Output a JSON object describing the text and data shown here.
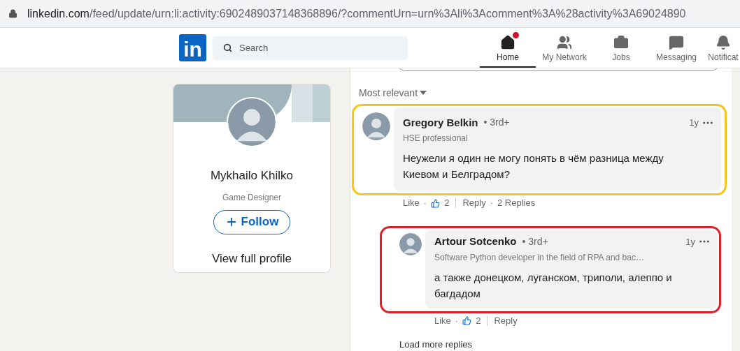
{
  "address_bar": {
    "url_host": "linkedin.com",
    "url_path": "/feed/update/urn:li:activity:6902489037148368896/?commentUrn=urn%3Ali%3Acomment%3A%28activity%3A69024890"
  },
  "header": {
    "logo": "in",
    "search": {
      "placeholder": "Search"
    },
    "nav": [
      {
        "label": "Home",
        "selected": true,
        "badge": true
      },
      {
        "label": "My Network",
        "selected": false,
        "badge": false
      },
      {
        "label": "Jobs",
        "selected": false,
        "badge": false
      },
      {
        "label": "Messaging",
        "selected": false,
        "badge": false
      },
      {
        "label": "Notificat",
        "selected": false,
        "badge": false
      }
    ]
  },
  "profile_card": {
    "name": "Mykhailo Khilko",
    "headline": "Game Designer",
    "follow_button": "Follow",
    "link": "View full profile"
  },
  "comments": {
    "sort": "Most relevant",
    "items": [
      {
        "author": "Gregory Belkin",
        "degree": "• 3rd+",
        "headline": "HSE professional",
        "time": "1y",
        "text": "Неужели я один не могу понять в чём разница между Киевом и Белградом?",
        "reply": false,
        "color": "#f5c518",
        "actions": {
          "like": "Like",
          "dot": "·",
          "reactions": "2",
          "reply": "Reply",
          "dot_2": "·",
          "replies": "2 Replies"
        }
      },
      {
        "author": "Artour Sotcenko",
        "degree": "• 3rd+",
        "headline": "Software Python developer in the field of RPA and bac…",
        "time": "1y",
        "text": "а также донецком, луганском, триполи, алеппо и багдадом",
        "reply": true,
        "color": "#e0202a",
        "actions": {
          "like": "Like",
          "dot": "·",
          "reactions": "2",
          "reply": "Reply"
        }
      }
    ],
    "load_more": "Load more replies"
  }
}
